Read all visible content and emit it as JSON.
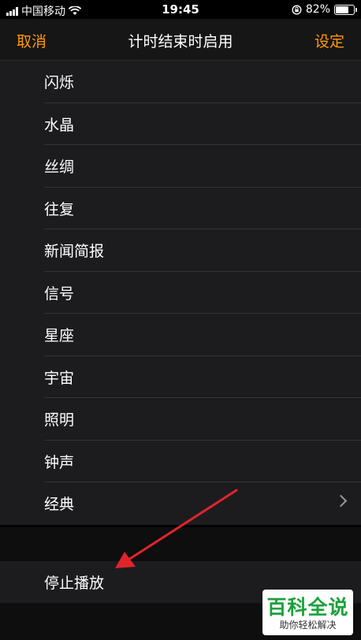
{
  "status_bar": {
    "carrier": "中国移动",
    "time": "19:45",
    "battery_percent": "82%",
    "battery_level": 0.82,
    "icons": [
      "signal-icon",
      "wifi-icon",
      "orientation-lock-icon",
      "battery-icon"
    ]
  },
  "navbar": {
    "cancel_label": "取消",
    "title": "计时结束时启用",
    "set_label": "设定"
  },
  "ringtones": [
    {
      "label": "闪烁"
    },
    {
      "label": "水晶"
    },
    {
      "label": "丝绸"
    },
    {
      "label": "往复"
    },
    {
      "label": "新闻简报"
    },
    {
      "label": "信号"
    },
    {
      "label": "星座"
    },
    {
      "label": "宇宙"
    },
    {
      "label": "照明"
    },
    {
      "label": "钟声"
    },
    {
      "label": "经典"
    }
  ],
  "stop_playing": {
    "label": "停止播放"
  },
  "watermark": {
    "title": "百科全说",
    "subtitle": "助你轻松解决"
  },
  "colors": {
    "accent": "#ff9a0a",
    "arrow": "#e0242c",
    "watermark_green": "#1aa23a"
  }
}
